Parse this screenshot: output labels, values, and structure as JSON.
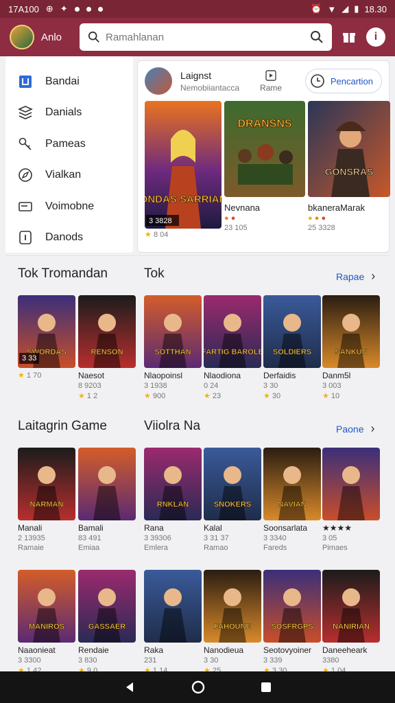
{
  "status_bar": {
    "time_left": "17A100",
    "time_right": "18.30"
  },
  "header": {
    "username": "Anlo",
    "search_placeholder": "Ramahlanan"
  },
  "sidebar": {
    "items": [
      {
        "label": "Bandai",
        "icon": "square-icon",
        "active": true
      },
      {
        "label": "Danials",
        "icon": "stack-icon",
        "active": false
      },
      {
        "label": "Pameas",
        "icon": "key-icon",
        "active": false
      },
      {
        "label": "Vialkan",
        "icon": "compass-icon",
        "active": false
      },
      {
        "label": "Voimobne",
        "icon": "card-icon",
        "active": false
      },
      {
        "label": "Danods",
        "icon": "info-square-icon",
        "active": false
      }
    ]
  },
  "featured": {
    "title": "Laignst",
    "subtitle": "Nemobiiantacca",
    "middle_label": "Rame",
    "pill_label": "Pencartion",
    "cards": [
      {
        "art_title": "SONDAS SARRIANS",
        "code": "3 3828",
        "rating": "8 04"
      },
      {
        "art_title": "DRANSNS",
        "title": "Nevnana",
        "meta": "23 105"
      },
      {
        "art_title": "GONSRAS",
        "title": "bkaneraMarak",
        "meta": "25 3328"
      }
    ]
  },
  "section1": {
    "title_left": "Tok Tromandan",
    "title_right": "Tok",
    "more_label": "Rapae",
    "cards": [
      {
        "art_title": "SWORDAS",
        "overlay": "3 33",
        "title": "",
        "sub": "",
        "rating": "1 70"
      },
      {
        "art_title": "RENSON",
        "title": "Naesot",
        "sub": "8 9203",
        "rating": "1 2"
      },
      {
        "art_title": "SOTTHAN",
        "title": "Nlaopoinsl",
        "sub": "3 1938",
        "rating": "900"
      },
      {
        "art_title": "FARTIG BAROLE",
        "title": "Nlaodiona",
        "sub": "0 24",
        "rating": "23"
      },
      {
        "art_title": "SOLDIERS",
        "title": "Derfaidis",
        "sub": "3 30",
        "rating": "30"
      },
      {
        "art_title": "SANKUN",
        "title": "Danm5l",
        "sub": "3 003",
        "rating": "10"
      }
    ]
  },
  "section2": {
    "title_left": "Laitagrin Game",
    "title_right": "Viiolra Na",
    "more_label": "Paone",
    "cards": [
      {
        "art_title": "NARMAN",
        "title": "Manali",
        "sub": "2 13935",
        "sub2": "Ramaie"
      },
      {
        "art_title": "",
        "title": "Bamali",
        "sub": "83 491",
        "sub2": "Emiaa"
      },
      {
        "art_title": "RNKLAN",
        "title": "Rana",
        "sub": "3 39306",
        "sub2": "Emlera"
      },
      {
        "art_title": "SNOKERS",
        "title": "Kalal",
        "sub": "3 31 37",
        "sub2": "Ramao"
      },
      {
        "art_title": "NAVIAN",
        "title": "Soonsarlata",
        "sub": "3 3340",
        "sub2": "Fareds"
      },
      {
        "art_title": "",
        "title": "★★★★",
        "sub": "3 05",
        "sub2": "Pimaes"
      }
    ]
  },
  "section3": {
    "cards": [
      {
        "art_title": "MANIROS",
        "title": "Naaonieat",
        "sub": "3 3300",
        "rating": "1 42"
      },
      {
        "art_title": "GASSAER",
        "title": "Rendaie",
        "sub": "3 830",
        "rating": "9 0"
      },
      {
        "art_title": "",
        "title": "Raka",
        "sub": "231",
        "rating": "1 14"
      },
      {
        "art_title": "FAHOUNE",
        "title": "Nanodieua",
        "sub": "3 30",
        "rating": "25"
      },
      {
        "art_title": "SOSFRGPS",
        "title": "Seotovyoiner",
        "sub": "3 339",
        "rating": "3 30"
      },
      {
        "art_title": "NANIRIAN",
        "title": "Daneeheark",
        "sub": "3380",
        "rating": "1 04"
      }
    ]
  },
  "colors": {
    "topbar": "#8e2c42",
    "status": "#7a2536",
    "accent": "#2156c9",
    "star": "#f2b300"
  }
}
